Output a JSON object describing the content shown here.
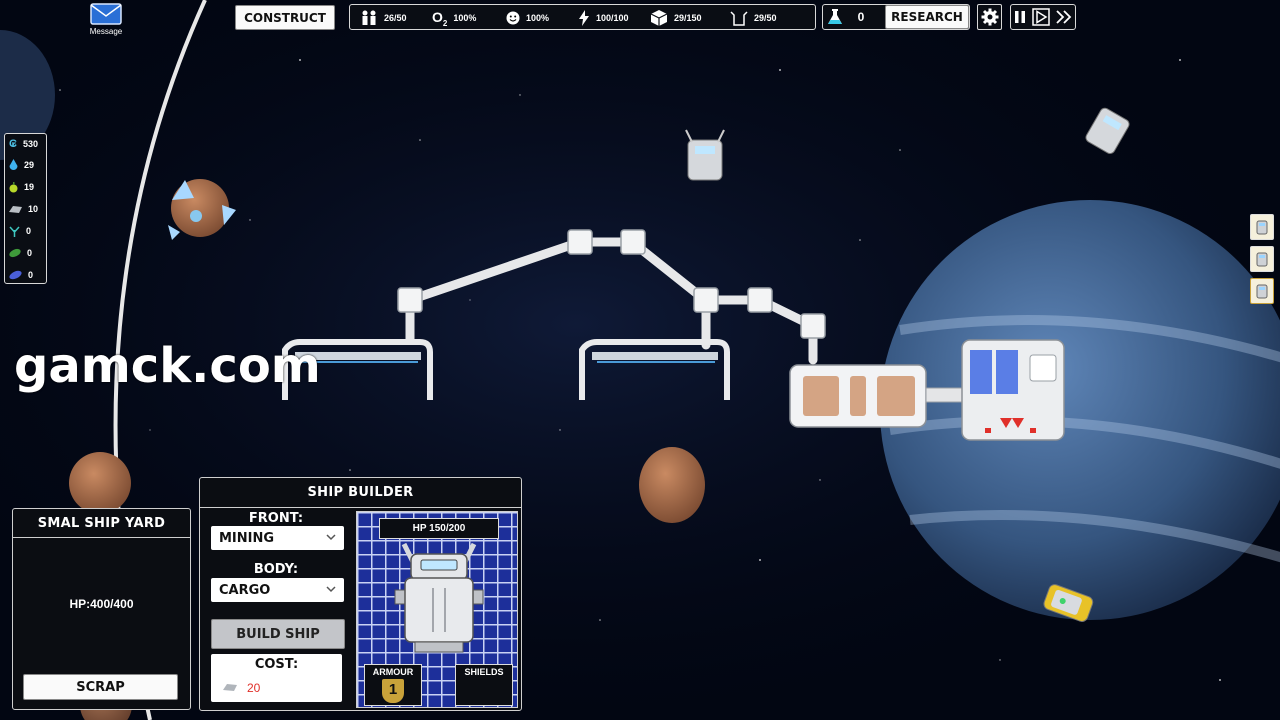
{
  "top_bar": {
    "message_label": "Message",
    "construct_label": "CONSTRUCT",
    "stats": {
      "crew": "26/50",
      "oxygen": "100%",
      "happiness": "100%",
      "power": "100/100",
      "storage": "29/150",
      "capacity": "29/50"
    },
    "research_count": "0",
    "research_label": "RESEARCH"
  },
  "resources": [
    {
      "icon": "credits-icon",
      "value": "530"
    },
    {
      "icon": "water-icon",
      "value": "29"
    },
    {
      "icon": "food-icon",
      "value": "19"
    },
    {
      "icon": "metal-icon",
      "value": "10"
    },
    {
      "icon": "plant-icon",
      "value": "0"
    },
    {
      "icon": "leaf-icon",
      "value": "0"
    },
    {
      "icon": "crystal-icon",
      "value": "0"
    }
  ],
  "watermark": "gamck.com",
  "shipyard": {
    "title": "SMAL SHIP YARD",
    "hp": "HP:400/400",
    "scrap_label": "SCRAP"
  },
  "ship_builder": {
    "title": "SHIP BUILDER",
    "front_label": "FRONT:",
    "front_value": "MINING",
    "body_label": "BODY:",
    "body_value": "CARGO",
    "build_label": "BUILD SHIP",
    "cost_label": "COST:",
    "cost_value": "20",
    "hp": "HP  150/200",
    "armour_label": "ARMOUR",
    "armour_value": "1",
    "shields_label": "SHIELDS"
  },
  "colors": {
    "space": "#020612",
    "grid_blue": "#1d2f9a",
    "armour_gold": "#c9a23a",
    "cost_red": "#e0302a",
    "planet_blue": "#3a5b8a"
  }
}
